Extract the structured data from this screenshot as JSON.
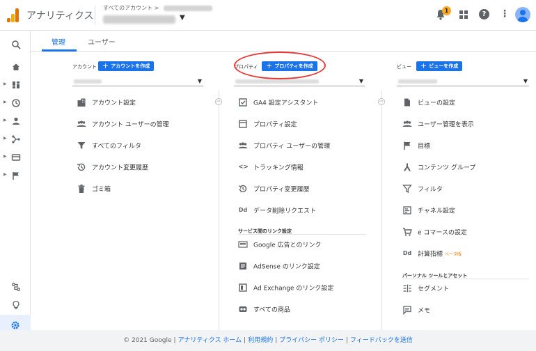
{
  "header": {
    "app_title": "アナリティクス",
    "breadcrumb": "すべてのアカウント",
    "breadcrumb_arrow": ">",
    "notification_count": "1"
  },
  "tabs": [
    {
      "label": "管理"
    },
    {
      "label": "ユーザー"
    }
  ],
  "columns": {
    "account": {
      "label": "アカウント",
      "create_button": "アカウントを作成",
      "items": [
        {
          "label": "アカウント設定",
          "icon": "building-icon"
        },
        {
          "label": "アカウント ユーザーの管理",
          "icon": "users-icon"
        },
        {
          "label": "すべてのフィルタ",
          "icon": "filter-icon"
        },
        {
          "label": "アカウント変更履歴",
          "icon": "history-icon"
        },
        {
          "label": "ゴミ箱",
          "icon": "trash-icon"
        }
      ]
    },
    "property": {
      "label": "プロパティ",
      "create_button": "プロパティを作成",
      "items": [
        {
          "label": "GA4 設定アシスタント",
          "icon": "checkbox-icon"
        },
        {
          "label": "プロパティ設定",
          "icon": "window-icon"
        },
        {
          "label": "プロパティ ユーザーの管理",
          "icon": "users-icon"
        },
        {
          "label": "トラッキング情報",
          "icon": "code-icon"
        },
        {
          "label": "プロパティ変更履歴",
          "icon": "history-icon"
        },
        {
          "label": "データ削除リクエスト",
          "icon": "dd-icon"
        }
      ],
      "section_title": "サービス間のリンク設定",
      "link_items": [
        {
          "label": "Google 広告とのリンク",
          "icon": "ads-icon"
        },
        {
          "label": "AdSense のリンク設定",
          "icon": "adsense-icon"
        },
        {
          "label": "Ad Exchange のリンク設定",
          "icon": "adx-icon"
        },
        {
          "label": "すべての商品",
          "icon": "link-icon"
        }
      ]
    },
    "view": {
      "label": "ビュー",
      "create_button": "ビューを作成",
      "items": [
        {
          "label": "ビューの設定",
          "icon": "document-icon"
        },
        {
          "label": "ユーザー管理を表示",
          "icon": "users-icon"
        },
        {
          "label": "目標",
          "icon": "flag-icon"
        },
        {
          "label": "コンテンツ グループ",
          "icon": "group-icon"
        },
        {
          "label": "フィルタ",
          "icon": "filter-icon"
        },
        {
          "label": "チャネル設定",
          "icon": "channel-icon"
        },
        {
          "label": "e コマースの設定",
          "icon": "cart-icon"
        },
        {
          "label": "計算指標",
          "icon": "dd-icon",
          "badge": "ベータ版"
        }
      ],
      "section_title": "パーソナル ツールとアセット",
      "tool_items": [
        {
          "label": "セグメント",
          "icon": "segment-icon"
        },
        {
          "label": "メモ",
          "icon": "comment-icon"
        }
      ]
    }
  },
  "footer": {
    "copyright": "© 2021 Google",
    "links": [
      "アナリティクス ホーム",
      "利用規約",
      "プライバシー ポリシー",
      "フィードバックを送信"
    ]
  },
  "colors": {
    "accent": "#1a73e8",
    "highlight_oval": "#e53935",
    "badge": "#f9a825"
  }
}
